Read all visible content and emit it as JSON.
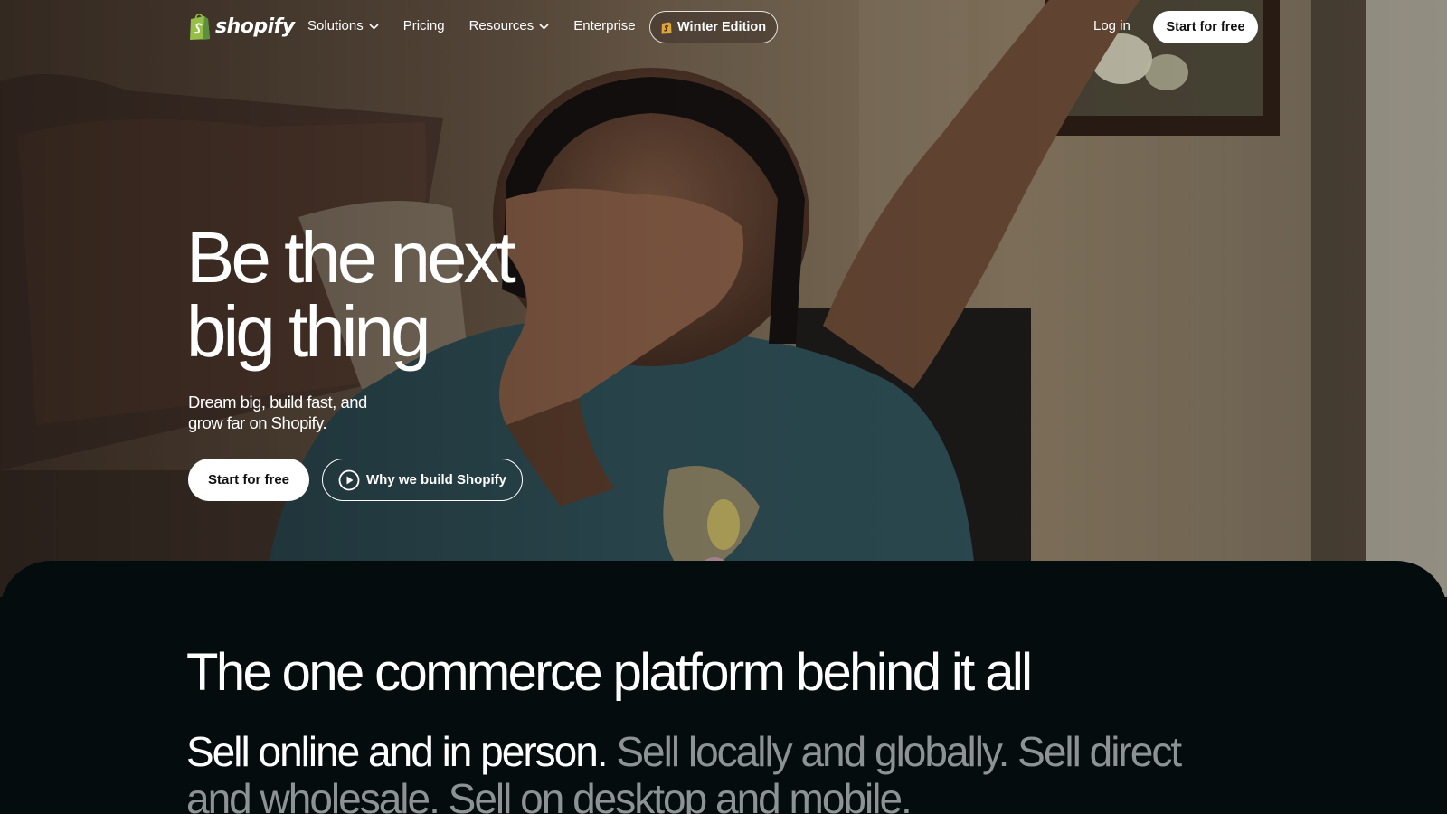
{
  "nav": {
    "logo_text": "shopify",
    "links": [
      {
        "label": "Solutions",
        "has_dropdown": true
      },
      {
        "label": "Pricing",
        "has_dropdown": false
      },
      {
        "label": "Resources",
        "has_dropdown": true
      },
      {
        "label": "Enterprise",
        "has_dropdown": false
      }
    ],
    "edition_label": "Winter Edition",
    "login_label": "Log in",
    "cta_label": "Start for free"
  },
  "hero": {
    "title_line1": "Be the next",
    "title_line2": "big thing",
    "subtitle": "Dream big, build fast, and grow far on Shopify.",
    "primary_cta": "Start for free",
    "video_cta": "Why we build Shopify"
  },
  "platform": {
    "title": "The one commerce platform behind it all",
    "text_strong": "Sell online and in person.",
    "text_muted": " Sell locally and globally. Sell direct and wholesale. Sell on desktop and mobile."
  },
  "colors": {
    "brand_green": "#95bf47",
    "dark_bg": "#050c0e",
    "muted_text": "#8d9294"
  },
  "icons": [
    "shopify-bag-icon",
    "chevron-down-icon",
    "shopify-coin-icon",
    "play-circle-icon"
  ]
}
